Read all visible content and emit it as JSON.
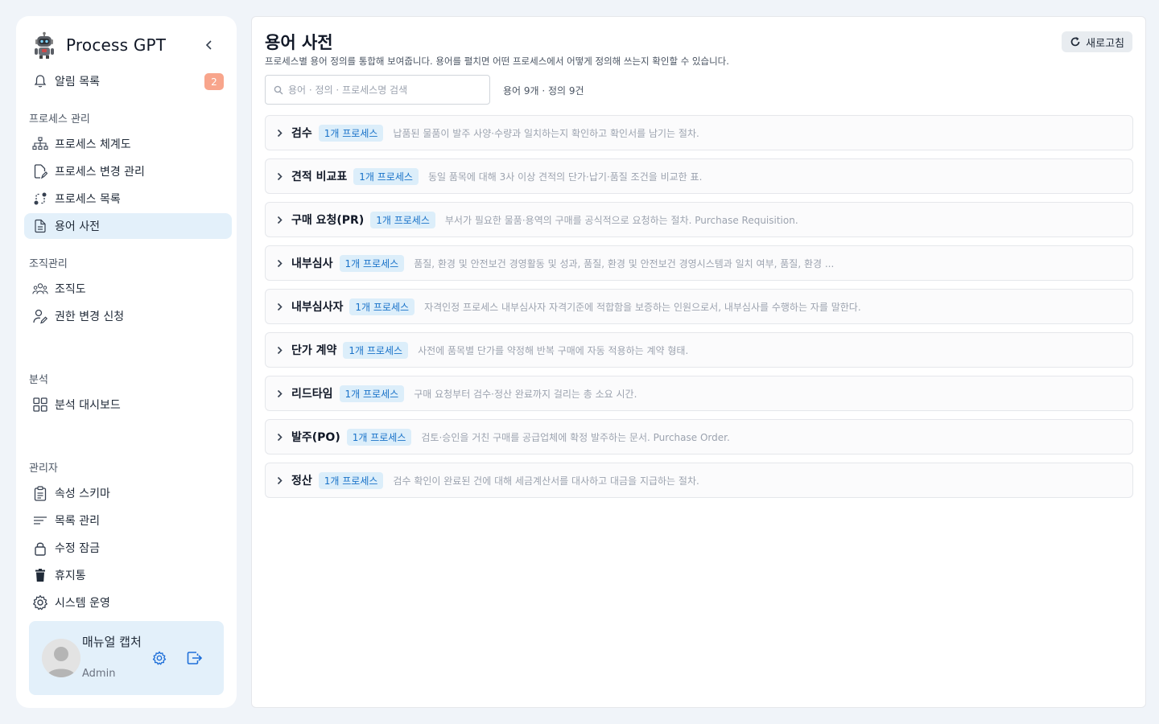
{
  "app": {
    "title": "Process GPT"
  },
  "sidebar": {
    "notifications": {
      "label": "알림 목록",
      "count": "2"
    },
    "sections": {
      "process": "프로세스 관리",
      "org": "조직관리",
      "analytics": "분석",
      "admin": "관리자"
    },
    "items": {
      "process_map": "프로세스 체계도",
      "process_change": "프로세스 변경 관리",
      "process_list": "프로세스 목록",
      "glossary": "용어 사전",
      "org_chart": "조직도",
      "permission_request": "권한 변경 신청",
      "analytics_dashboard": "분석 대시보드",
      "attribute_schema": "속성 스키마",
      "list_management": "목록 관리",
      "edit_lock": "수정 잠금",
      "trash": "휴지통",
      "system_ops": "시스템 운영"
    },
    "user": {
      "name": "매뉴얼 캡처",
      "role": "Admin"
    }
  },
  "main": {
    "title": "용어 사전",
    "subtitle": "프로세스별 용어 정의를 통합해 보여줍니다. 용어를 펼치면 어떤 프로세스에서 어떻게 정의해 쓰는지 확인할 수 있습니다.",
    "refresh_label": "새로고침",
    "search_placeholder": "용어 · 정의 · 프로세스명 검색",
    "count_text": "용어 9개 · 정의 9건",
    "terms": [
      {
        "term": "검수",
        "process_count": "1개 프로세스",
        "definition": "납품된 물품이 발주 사양·수량과 일치하는지 확인하고 확인서를 남기는 절차."
      },
      {
        "term": "견적 비교표",
        "process_count": "1개 프로세스",
        "definition": "동일 품목에 대해 3사 이상 견적의 단가·납기·품질 조건을 비교한 표."
      },
      {
        "term": "구매 요청(PR)",
        "process_count": "1개 프로세스",
        "definition": "부서가 필요한 물품·용역의 구매를 공식적으로 요청하는 절차. Purchase Requisition."
      },
      {
        "term": "내부심사",
        "process_count": "1개 프로세스",
        "definition": "품질, 환경 및 안전보건 경영활동 및 성과, 품질, 환경 및 안전보건 경영시스템과 일치 여부, 품질, 환경 ..."
      },
      {
        "term": "내부심사자",
        "process_count": "1개 프로세스",
        "definition": "자격인정 프로세스 내부심사자 자격기준에 적합함을 보증하는 인원으로서, 내부심사를 수행하는 자를 말한다."
      },
      {
        "term": "단가 계약",
        "process_count": "1개 프로세스",
        "definition": "사전에 품목별 단가를 약정해 반복 구매에 자동 적용하는 계약 형태."
      },
      {
        "term": "리드타임",
        "process_count": "1개 프로세스",
        "definition": "구매 요청부터 검수·정산 완료까지 걸리는 총 소요 시간."
      },
      {
        "term": "발주(PO)",
        "process_count": "1개 프로세스",
        "definition": "검토·승인을 거친 구매를 공급업체에 확정 발주하는 문서. Purchase Order."
      },
      {
        "term": "정산",
        "process_count": "1개 프로세스",
        "definition": "검수 확인이 완료된 건에 대해 세금계산서를 대사하고 대금을 지급하는 절차."
      }
    ]
  },
  "colors": {
    "accent": "#1e6fd9",
    "active_bg": "#e3f0fa",
    "badge": "#f8a58c",
    "pill_bg": "#dceefa",
    "pill_text": "#1a73c9"
  }
}
